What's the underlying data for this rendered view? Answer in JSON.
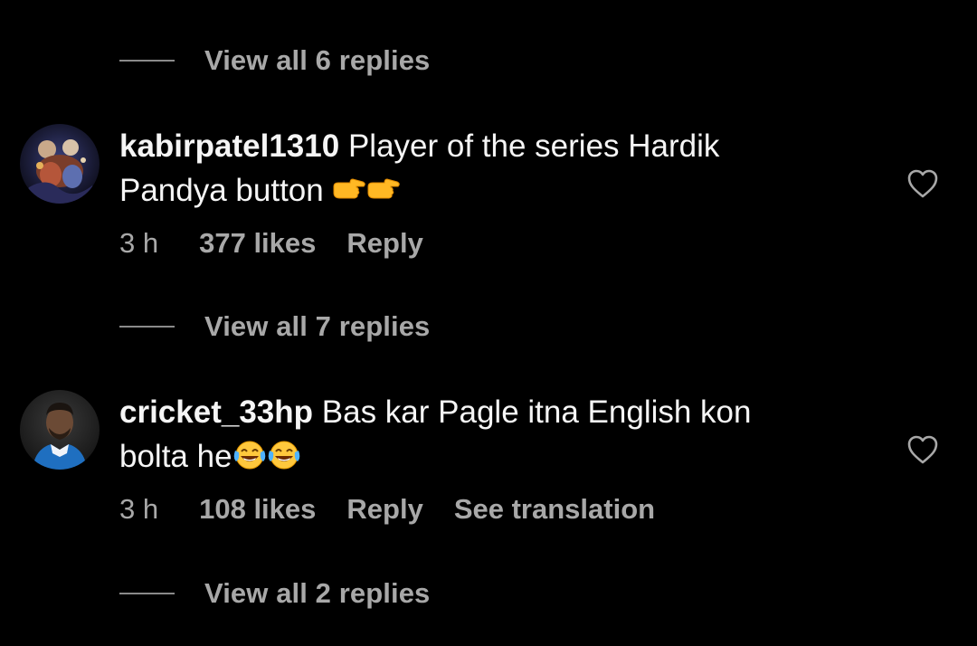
{
  "thread": {
    "top_replies": {
      "label": "View all 6 replies"
    },
    "comments": [
      {
        "username": "kabirpatel1310",
        "text": "Player of the series Hardik Pandya button",
        "emoji_name": "backhand-index-pointing-right",
        "time": "3 h",
        "likes": "377 likes",
        "reply": "Reply",
        "avatar_icon": "avatar-artwork",
        "replies_label": "View all 7 replies"
      },
      {
        "username": "cricket_33hp",
        "text_line1": "Bas kar Pagle itna English kon",
        "text_line2": "bolta he",
        "emoji_name": "face-with-tears-of-joy",
        "time": "3 h",
        "likes": "108 likes",
        "reply": "Reply",
        "translate": "See translation",
        "avatar_icon": "avatar-player-photo",
        "replies_label": "View all 2 replies"
      }
    ]
  },
  "colors": {
    "background": "#000000",
    "primary_text": "#f5f5f5",
    "secondary_text": "#a8a8a8",
    "divider": "#8a8a8a"
  }
}
